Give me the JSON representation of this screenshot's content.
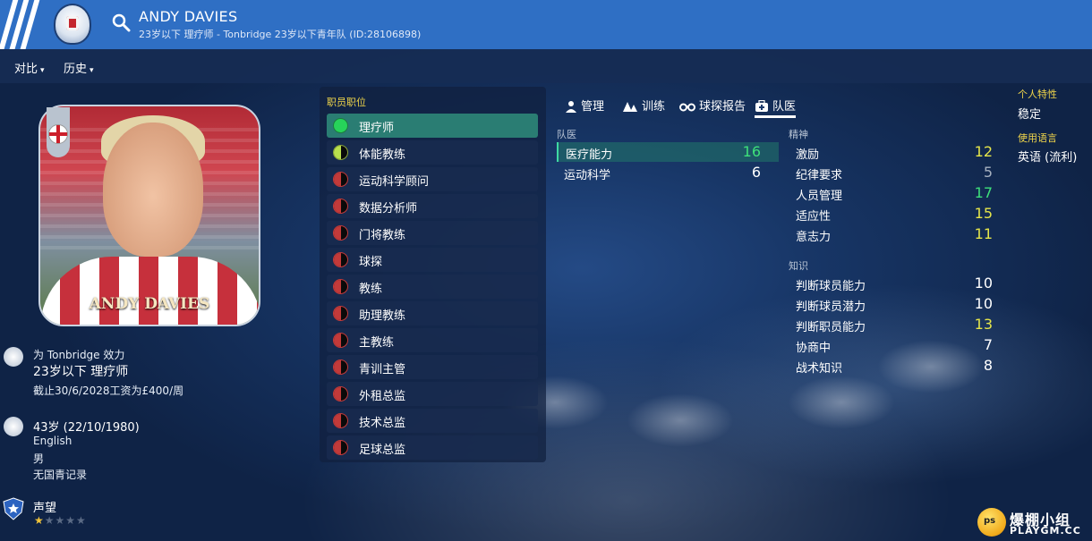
{
  "header": {
    "name": "ANDY DAVIES",
    "subtitle": "23岁以下 理疗师 - Tonbridge 23岁以下青年队 (ID:28106898)"
  },
  "menu": {
    "compare": "对比",
    "history": "历史"
  },
  "portrait": {
    "caption": "ANDY DAVIES"
  },
  "info": {
    "club_line": "为 Tonbridge 效力",
    "role_line": "23岁以下 理疗师",
    "contract_line": "截止30/6/2028工资为£400/周",
    "age_line": "43岁 (22/10/1980)",
    "nationality": "English",
    "gender": "男",
    "youth_record": "无国青记录",
    "reputation_label": "声望",
    "reputation_stars": "★★★★★",
    "reputation_value": 1,
    "reputation_max": 5
  },
  "roles": {
    "title": "职员职位",
    "items": [
      {
        "label": "理疗师"
      },
      {
        "label": "体能教练"
      },
      {
        "label": "运动科学顾问"
      },
      {
        "label": "数据分析师"
      },
      {
        "label": "门将教练"
      },
      {
        "label": "球探"
      },
      {
        "label": "教练"
      },
      {
        "label": "助理教练"
      },
      {
        "label": "主教练"
      },
      {
        "label": "青训主管"
      },
      {
        "label": "外租总监"
      },
      {
        "label": "技术总监"
      },
      {
        "label": "足球总监"
      }
    ]
  },
  "tabs": {
    "manage": "管理",
    "training": "训练",
    "scout_report": "球探报告",
    "medical": "队医"
  },
  "medical": {
    "title": "队医",
    "rows": [
      {
        "name": "医疗能力",
        "value": "16"
      },
      {
        "name": "运动科学",
        "value": "6"
      }
    ]
  },
  "mental": {
    "title": "精神",
    "rows": [
      {
        "name": "激励",
        "value": "12"
      },
      {
        "name": "纪律要求",
        "value": "5"
      },
      {
        "name": "人员管理",
        "value": "17"
      },
      {
        "name": "适应性",
        "value": "15"
      },
      {
        "name": "意志力",
        "value": "11"
      }
    ]
  },
  "knowledge": {
    "title": "知识",
    "rows": [
      {
        "name": "判断球员能力",
        "value": "10"
      },
      {
        "name": "判断球员潜力",
        "value": "10"
      },
      {
        "name": "判断职员能力",
        "value": "13"
      },
      {
        "name": "协商中",
        "value": "7"
      },
      {
        "name": "战术知识",
        "value": "8"
      }
    ]
  },
  "traits": {
    "personality_title": "个人特性",
    "personality_value": "稳定",
    "language_title": "使用语言",
    "language_value": "英语 (流利)"
  },
  "watermark": {
    "badge": "ps",
    "cn": "爆棚小组",
    "en": "PLAYGM.CC"
  },
  "colors": {
    "header_blue": "#2f6fc4",
    "selected_teal": "#2a7d73",
    "attr_green": "#3ee07a",
    "attr_yellow": "#e6e64a",
    "section_yellow": "#f0d54a"
  }
}
